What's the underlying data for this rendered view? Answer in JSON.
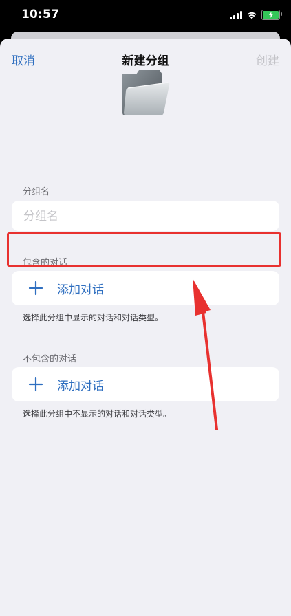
{
  "status_bar": {
    "time": "10:57"
  },
  "nav": {
    "cancel_label": "取消",
    "title": "新建分组",
    "create_label": "创建"
  },
  "group_name": {
    "section_label": "分组名",
    "placeholder": "分组名",
    "value": ""
  },
  "included": {
    "section_label": "包含的对话",
    "add_label": "添加对话",
    "footnote": "选择此分组中显示的对话和对话类型。"
  },
  "excluded": {
    "section_label": "不包含的对话",
    "add_label": "添加对话",
    "footnote": "选择此分组中不显示的对话和对话类型。"
  },
  "colors": {
    "accent": "#2f6fc0",
    "annotation": "#e8312f",
    "background": "#f0f0f5"
  },
  "icons": {
    "folder": "folder-icon",
    "plus": "plus-icon",
    "wifi": "wifi-icon",
    "signal": "cellular-signal-icon",
    "battery": "battery-charging-icon"
  }
}
